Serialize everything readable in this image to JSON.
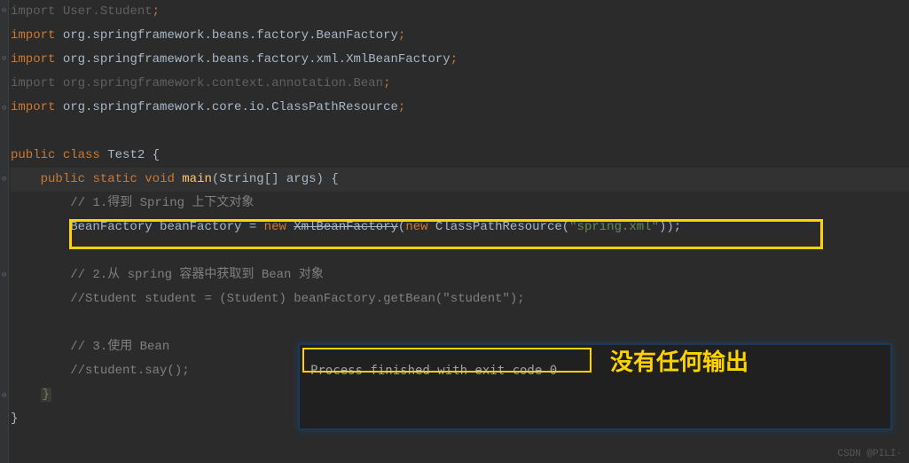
{
  "imports": {
    "l1_kw": "import",
    "l1_pkg": "User.Student",
    "l2_kw": "import",
    "l2_pkg": "org.springframework.beans.factory.BeanFactory",
    "l3_kw": "import",
    "l3_pkg": "org.springframework.beans.factory.xml.XmlBeanFactory",
    "l4_kw": "import",
    "l4_pkg": "org.springframework.context.annotation.Bean",
    "l5_kw": "import",
    "l5_pkg": "org.springframework.core.io.ClassPathResource"
  },
  "classDecl": {
    "kw_public": "public",
    "kw_class": "class",
    "name": "Test2",
    "brace": "{"
  },
  "mainDecl": {
    "kw_public": "public",
    "kw_static": "static",
    "kw_void": "void",
    "name": "main",
    "params": "(String[] args)",
    "brace": "{"
  },
  "body": {
    "c1": "// 1.得到 Spring 上下文对象",
    "bf_type": "BeanFactory",
    "bf_var": " beanFactory ",
    "bf_eq": "= ",
    "bf_new1": "new ",
    "bf_xml": "XmlBeanFactory",
    "bf_p1": "(",
    "bf_new2": "new ",
    "bf_cpr": "ClassPathResource",
    "bf_p2": "(",
    "bf_str": "\"spring.xml\"",
    "bf_p3": "));",
    "c2": "// 2.从 spring 容器中获取到 Bean 对象",
    "c2b": "//Student student = (Student) beanFactory.getBean(\"student\");",
    "c3": "// 3.使用 Bean",
    "c3b": "//student.say();",
    "braceClose1": "}",
    "braceClose2": "}"
  },
  "console": {
    "empty": " ",
    "result": "Process finished with exit code 0"
  },
  "annotation": {
    "label": "没有任何输出"
  },
  "watermark": "CSDN @PILI-"
}
